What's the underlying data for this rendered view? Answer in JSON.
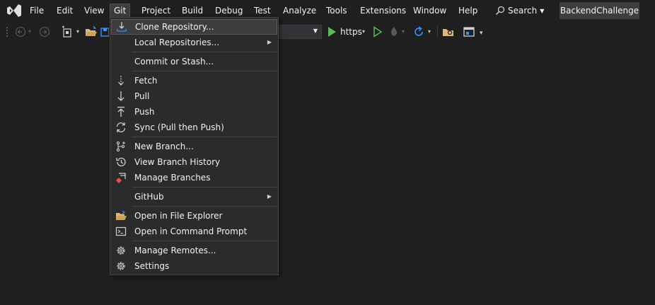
{
  "menubar": {
    "items": [
      "File",
      "Edit",
      "View",
      "Git",
      "Project",
      "Build",
      "Debug",
      "Test",
      "Analyze",
      "Tools",
      "Extensions",
      "Window",
      "Help"
    ],
    "active": "Git",
    "search_label": "Search",
    "solution_name": "BackendChallenge"
  },
  "toolbar": {
    "run_profile": "https"
  },
  "git_menu": {
    "items": [
      {
        "label": "Clone Repository...",
        "icon": "clone-repository-icon"
      },
      {
        "label": "Local Repositories...",
        "icon": "",
        "submenu": true
      },
      {
        "label": "Commit or Stash...",
        "icon": ""
      },
      {
        "label": "Fetch",
        "icon": "fetch-icon"
      },
      {
        "label": "Pull",
        "icon": "pull-icon"
      },
      {
        "label": "Push",
        "icon": "push-icon"
      },
      {
        "label": "Sync (Pull then Push)",
        "icon": "sync-icon"
      },
      {
        "label": "New Branch...",
        "icon": "new-branch-icon"
      },
      {
        "label": "View Branch History",
        "icon": "history-icon"
      },
      {
        "label": "Manage Branches",
        "icon": "manage-branches-icon"
      },
      {
        "label": "GitHub",
        "icon": "",
        "submenu": true
      },
      {
        "label": "Open in File Explorer",
        "icon": "folder-open-icon"
      },
      {
        "label": "Open in Command Prompt",
        "icon": "terminal-icon"
      },
      {
        "label": "Manage Remotes...",
        "icon": "gear-icon"
      },
      {
        "label": "Settings",
        "icon": "gear-icon"
      }
    ]
  },
  "colors": {
    "background": "#1f1f1f",
    "menu_background": "#2b2b2b",
    "highlight": "#3d3d3d",
    "run_green": "#5cb85c",
    "accent_blue": "#3794ff",
    "folder_yellow": "#dcb67a"
  }
}
